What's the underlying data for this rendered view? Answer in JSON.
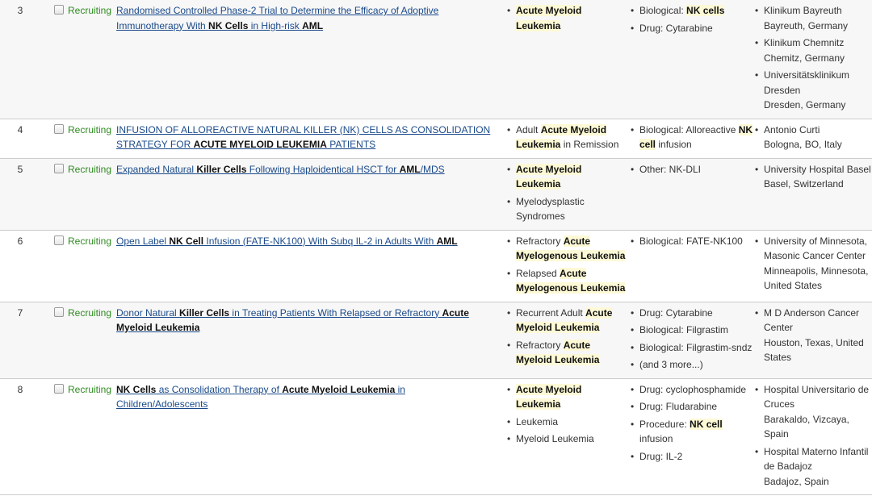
{
  "rows": [
    {
      "num": "3",
      "status": "Recruiting",
      "title": [
        {
          "t": "Randomised Controlled Phase-2 Trial to Determine the Efficacy of Adoptive Immunotherapy With ",
          "b": false
        },
        {
          "t": "NK Cells",
          "b": true
        },
        {
          "t": " in High-risk ",
          "b": false
        },
        {
          "t": "AML",
          "b": true
        }
      ],
      "conditions": [
        [
          {
            "t": "Acute Myeloid Leukemia",
            "b": true
          }
        ]
      ],
      "interventions": [
        [
          {
            "t": "Biological: ",
            "b": false
          },
          {
            "t": "NK cells",
            "b": true
          }
        ],
        [
          {
            "t": "Drug: Cytarabine",
            "b": false
          }
        ]
      ],
      "locations": [
        [
          "Klinikum Bayreuth",
          "Bayreuth, Germany"
        ],
        [
          "Klinikum Chemnitz",
          "Chemitz, Germany"
        ],
        [
          "Universitätsklinikum Dresden",
          "Dresden, Germany"
        ]
      ]
    },
    {
      "num": "4",
      "status": "Recruiting",
      "title": [
        {
          "t": "INFUSION OF ALLOREACTIVE NATURAL KILLER (NK) CELLS AS CONSOLIDATION STRATEGY FOR ",
          "b": false
        },
        {
          "t": "ACUTE MYELOID LEUKEMIA",
          "b": true
        },
        {
          "t": " PATIENTS",
          "b": false
        }
      ],
      "conditions": [
        [
          {
            "t": "Adult ",
            "b": false
          },
          {
            "t": "Acute Myeloid Leukemia",
            "b": true
          },
          {
            "t": " in Remission",
            "b": false
          }
        ]
      ],
      "interventions": [
        [
          {
            "t": "Biological: Alloreactive ",
            "b": false
          },
          {
            "t": "NK cell",
            "b": true
          },
          {
            "t": " infusion",
            "b": false
          }
        ]
      ],
      "locations": [
        [
          "Antonio Curti",
          "Bologna, BO, Italy"
        ]
      ]
    },
    {
      "num": "5",
      "status": "Recruiting",
      "title": [
        {
          "t": "Expanded Natural ",
          "b": false
        },
        {
          "t": "Killer Cells",
          "b": true
        },
        {
          "t": " Following Haploidentical HSCT for ",
          "b": false
        },
        {
          "t": "AML",
          "b": true
        },
        {
          "t": "/MDS",
          "b": false
        }
      ],
      "conditions": [
        [
          {
            "t": "Acute Myeloid Leukemia",
            "b": true
          }
        ],
        [
          {
            "t": "Myelodysplastic Syndromes",
            "b": false
          }
        ]
      ],
      "interventions": [
        [
          {
            "t": "Other: NK-DLI",
            "b": false
          }
        ]
      ],
      "locations": [
        [
          "University Hospital Basel",
          "Basel, Switzerland"
        ]
      ]
    },
    {
      "num": "6",
      "status": "Recruiting",
      "title": [
        {
          "t": "Open Label ",
          "b": false
        },
        {
          "t": "NK Cell",
          "b": true
        },
        {
          "t": " Infusion (FATE-NK100) With Subq IL-2 in Adults With ",
          "b": false
        },
        {
          "t": "AML",
          "b": true
        }
      ],
      "conditions": [
        [
          {
            "t": "Refractory ",
            "b": false
          },
          {
            "t": "Acute Myelogenous Leukemia",
            "b": true
          }
        ],
        [
          {
            "t": "Relapsed ",
            "b": false
          },
          {
            "t": "Acute Myelogenous Leukemia",
            "b": true
          }
        ]
      ],
      "interventions": [
        [
          {
            "t": "Biological: FATE-NK100",
            "b": false
          }
        ]
      ],
      "locations": [
        [
          "University of Minnesota, Masonic Cancer Center",
          "Minneapolis, Minnesota, United States"
        ]
      ]
    },
    {
      "num": "7",
      "status": "Recruiting",
      "title": [
        {
          "t": "Donor Natural ",
          "b": false
        },
        {
          "t": "Killer Cells",
          "b": true
        },
        {
          "t": " in Treating Patients With Relapsed or Refractory ",
          "b": false
        },
        {
          "t": "Acute Myeloid Leukemia",
          "b": true
        }
      ],
      "conditions": [
        [
          {
            "t": "Recurrent Adult ",
            "b": false
          },
          {
            "t": "Acute Myeloid Leukemia",
            "b": true
          }
        ],
        [
          {
            "t": "Refractory ",
            "b": false
          },
          {
            "t": "Acute Myeloid Leukemia",
            "b": true
          }
        ]
      ],
      "interventions": [
        [
          {
            "t": "Drug: Cytarabine",
            "b": false
          }
        ],
        [
          {
            "t": "Biological: Filgrastim",
            "b": false
          }
        ],
        [
          {
            "t": "Biological: Filgrastim-sndz",
            "b": false
          }
        ],
        [
          {
            "t": "(and 3 more...)",
            "b": false
          }
        ]
      ],
      "locations": [
        [
          "M D Anderson Cancer Center",
          "Houston, Texas, United States"
        ]
      ]
    },
    {
      "num": "8",
      "status": "Recruiting",
      "title": [
        {
          "t": "NK Cells",
          "b": true
        },
        {
          "t": " as Consolidation Therapy of ",
          "b": false
        },
        {
          "t": "Acute Myeloid Leukemia",
          "b": true
        },
        {
          "t": " in Children/Adolescents",
          "b": false
        }
      ],
      "conditions": [
        [
          {
            "t": "Acute Myeloid Leukemia",
            "b": true
          }
        ],
        [
          {
            "t": "Leukemia",
            "b": false
          }
        ],
        [
          {
            "t": "Myeloid Leukemia",
            "b": false
          }
        ]
      ],
      "interventions": [
        [
          {
            "t": "Drug: cyclophosphamide",
            "b": false
          }
        ],
        [
          {
            "t": "Drug: Fludarabine",
            "b": false
          }
        ],
        [
          {
            "t": "Procedure: ",
            "b": false
          },
          {
            "t": "NK cell",
            "b": true
          },
          {
            "t": " infusion",
            "b": false
          }
        ],
        [
          {
            "t": "Drug: IL-2",
            "b": false
          }
        ]
      ],
      "locations": [
        [
          "Hospital Universitario de Cruces",
          "Barakaldo, Vizcaya, Spain"
        ],
        [
          "Hospital Materno Infantil de Badajoz",
          "Badajoz, Spain"
        ]
      ]
    }
  ]
}
